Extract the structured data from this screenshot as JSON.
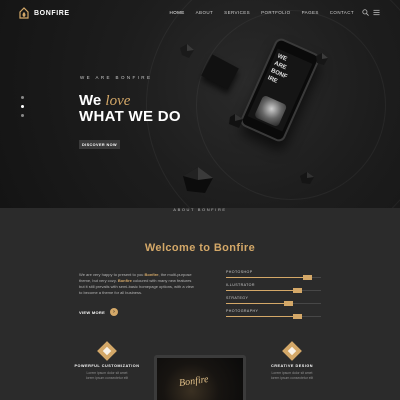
{
  "brand": {
    "name": "BONFIRE",
    "accent": "#d4a868"
  },
  "nav": {
    "items": [
      {
        "label": "HOME",
        "active": true
      },
      {
        "label": "ABOUT",
        "active": false
      },
      {
        "label": "SERVICES",
        "active": false
      },
      {
        "label": "PORTFOLIO",
        "active": false
      },
      {
        "label": "PAGES",
        "active": false
      },
      {
        "label": "CONTACT",
        "active": false
      }
    ],
    "icons": [
      "search-icon",
      "menu-icon"
    ]
  },
  "hero": {
    "tagline": "WE ARE BONFIRE",
    "headline_we": "We",
    "headline_love": "love",
    "headline_line2": "WHAT WE DO",
    "button": "DISCOVER NOW",
    "slider_dots": 3,
    "active_dot": 2,
    "phone_text": [
      "WE",
      "ARE",
      "BONF",
      "IRE"
    ]
  },
  "about": {
    "kicker": "ABOUT BONFIRE",
    "title": "Welcome to Bonfire",
    "text_p1": "We are very happy to present to you ",
    "text_b1": "Bonfire",
    "text_p2": ", the multi-purpose theme, but very cozy. ",
    "text_b2": "Bonfire",
    "text_p3": " coloured with many new features but it still prevails with semi-basic homepage options, with a view to become a theme for all business.",
    "view_more": "VIEW MORE",
    "skills": [
      {
        "label": "PHOTOSHOP",
        "percent": 90
      },
      {
        "label": "ILLUSTRATOR",
        "percent": 80
      },
      {
        "label": "STRATEGY",
        "percent": 70
      },
      {
        "label": "PHOTOGRAPHY",
        "percent": 80
      }
    ]
  },
  "services": [
    {
      "title": "POWERFUL CUSTOMIZATION",
      "desc_line1": "Lorem ipsum dolor sit amet",
      "desc_line2": "lorem ipsum consectetur elit"
    },
    {
      "title": "CREATIVE DESIGN",
      "desc_line1": "Lorem ipsum dolor sit amet",
      "desc_line2": "lorem ipsum consectetur elit"
    }
  ],
  "laptop": {
    "word": "Bonfire"
  }
}
